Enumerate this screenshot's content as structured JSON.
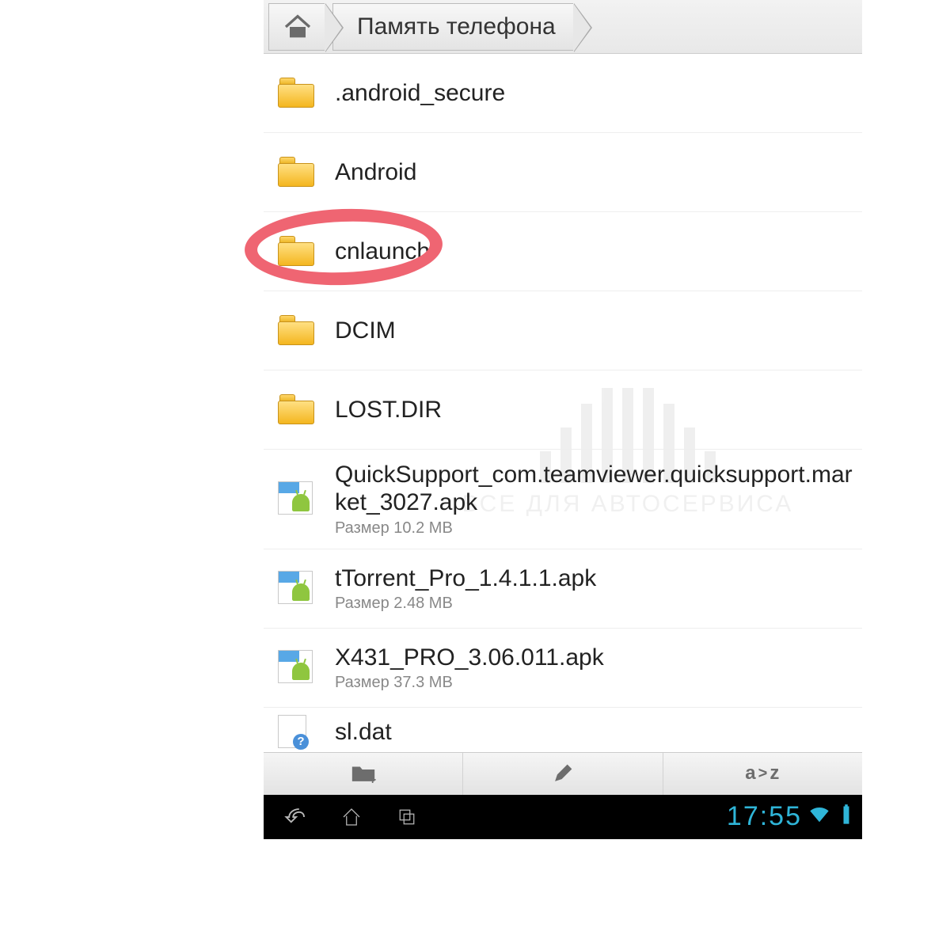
{
  "breadcrumb": {
    "current": "Память телефона"
  },
  "size_label_prefix": "Размер ",
  "items": [
    {
      "type": "folder",
      "name": ".android_secure"
    },
    {
      "type": "folder",
      "name": "Android"
    },
    {
      "type": "folder",
      "name": "cnlaunch",
      "highlighted": true
    },
    {
      "type": "folder",
      "name": "DCIM"
    },
    {
      "type": "folder",
      "name": "LOST.DIR"
    },
    {
      "type": "apk",
      "name": "QuickSupport_com.teamviewer.quicksupport.market_3027.apk",
      "size": "10.2 MB"
    },
    {
      "type": "apk",
      "name": "tTorrent_Pro_1.4.1.1.apk",
      "size": "2.48 MB"
    },
    {
      "type": "apk",
      "name": "X431_PRO_3.06.011.apk",
      "size": "37.3 MB"
    },
    {
      "type": "file",
      "name": "sl.dat"
    }
  ],
  "toolbar": {
    "new_folder": "new-folder",
    "edit": "edit",
    "sort": "a>z"
  },
  "statusbar": {
    "time": "17:55"
  },
  "watermark": {
    "line1": "ВСЕ ДЛЯ АВТОСЕРВИСА"
  }
}
